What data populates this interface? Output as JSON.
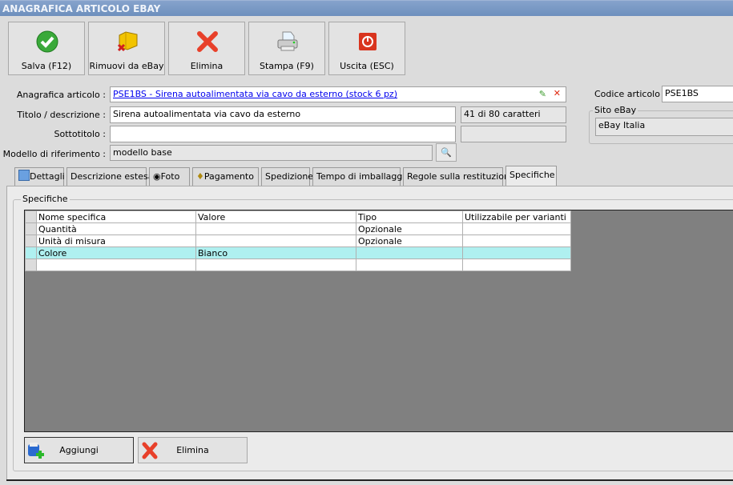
{
  "window": {
    "title": "ANAGRAFICA ARTICOLO EBAY"
  },
  "toolbar": [
    {
      "label": "Salva (F12)",
      "icon": "check-icon"
    },
    {
      "label": "Rimuovi da eBay",
      "icon": "box-remove-icon"
    },
    {
      "label": "Elimina",
      "icon": "delete-icon"
    },
    {
      "label": "Stampa (F9)",
      "icon": "printer-icon"
    },
    {
      "label": "Uscita (ESC)",
      "icon": "power-icon"
    }
  ],
  "form": {
    "anagrafica_label": "Anagrafica articolo :",
    "anagrafica_value": "PSE1BS - Sirena autoalimentata via cavo da esterno (stock 6 pz)",
    "titolo_label": "Titolo / descrizione :",
    "titolo_value": "Sirena autoalimentata via cavo da esterno",
    "titolo_counter": "41 di 80 caratteri",
    "sottotitolo_label": "Sottotitolo :",
    "sottotitolo_value": "",
    "modello_label": "Modello di riferimento :",
    "modello_value": "modello base",
    "codice_label": "Codice articolo :",
    "codice_value": "PSE1BS",
    "sito_label": "Sito eBay",
    "sito_value": "eBay Italia"
  },
  "tabs": [
    "Dettagli",
    "Descrizione estesa",
    "Foto",
    "Pagamento",
    "Spedizione",
    "Tempo di imballaggio",
    "Regole sulla restituzione",
    "Specifiche"
  ],
  "active_tab": "Specifiche",
  "specifiche": {
    "group_label": "Specifiche",
    "columns": [
      "Nome specifica",
      "Valore",
      "Tipo",
      "Utilizzabile per varianti"
    ],
    "rows": [
      [
        "Quantità",
        "",
        "Opzionale",
        ""
      ],
      [
        "Unità di misura",
        "",
        "Opzionale",
        ""
      ],
      [
        "Colore",
        "Bianco",
        "",
        ""
      ],
      [
        "",
        "",
        "",
        ""
      ]
    ],
    "add_label": "Aggiungi",
    "delete_label": "Elimina"
  }
}
